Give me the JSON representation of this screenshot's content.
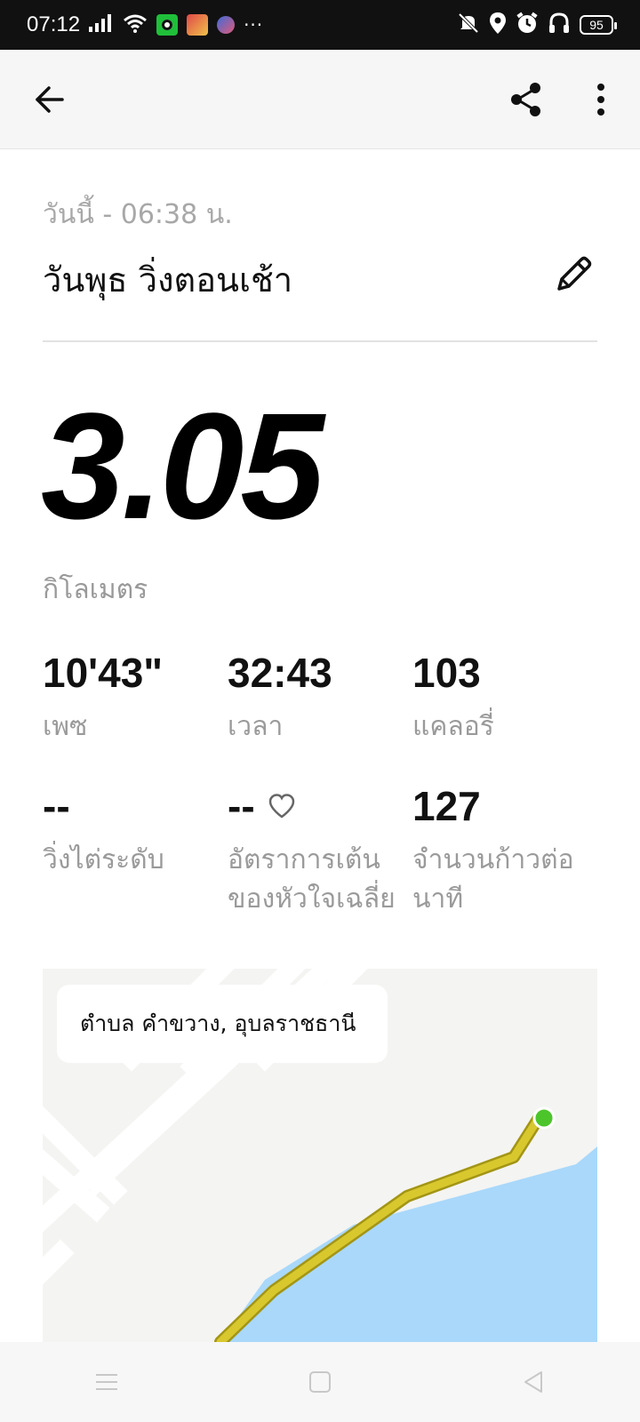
{
  "status_bar": {
    "time": "07:12",
    "battery": "95",
    "more_notifications": "···",
    "icons": [
      "signal-icon",
      "wifi-icon",
      "mute-icon",
      "location-icon",
      "alarm-icon",
      "headphones-icon"
    ]
  },
  "app_bar": {
    "back_icon": "arrow-left-icon",
    "share_icon": "share-icon",
    "more_icon": "more-vertical-icon"
  },
  "activity": {
    "date": "วันนี้ - 06:38 น.",
    "title": "วันพุธ วิ่งตอนเช้า",
    "distance": "3.05",
    "distance_unit": "กิโลเมตร"
  },
  "stats": [
    {
      "value": "10'43\"",
      "label": "เพซ"
    },
    {
      "value": "32:43",
      "label": "เวลา"
    },
    {
      "value": "103",
      "label": "แคลอรี่"
    },
    {
      "value": "--",
      "label": "วิ่งไต่ระดับ"
    },
    {
      "value": "--",
      "label": "อัตราการเต้นของหัวใจเฉลี่ย"
    },
    {
      "value": "127",
      "label": "จำนวนก้าวต่อนาที"
    }
  ],
  "map": {
    "location": "ตำบล คำขวาง, อุบลราชธานี",
    "colors": {
      "water": "#a9d8fb",
      "route": "#d8c82e",
      "route_outline": "#a39515",
      "start_dot": "#4cc52a"
    }
  },
  "nav_bar": {
    "icons": [
      "menu-icon",
      "home-square-icon",
      "back-triangle-icon"
    ]
  }
}
